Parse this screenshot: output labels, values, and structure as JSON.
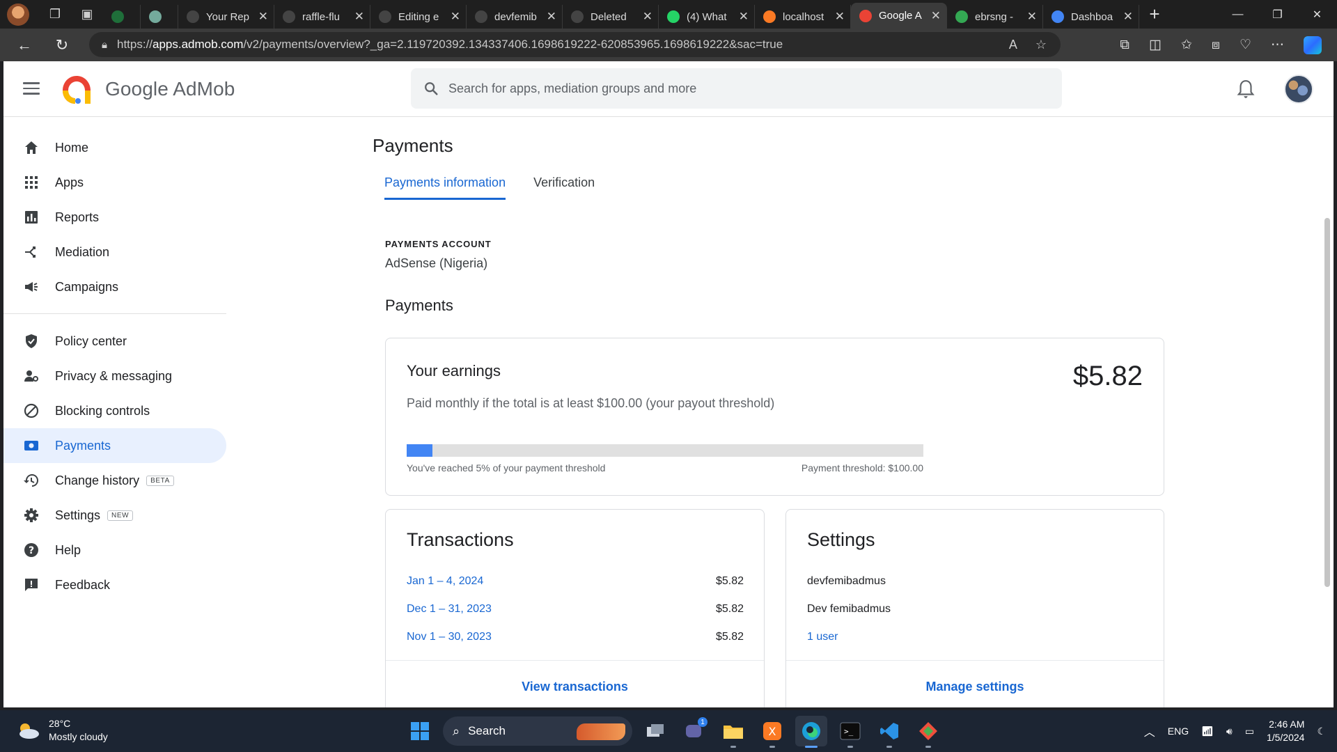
{
  "browser": {
    "tabs": [
      {
        "label": "",
        "favicon": "w-icon",
        "color": "#1f6f3a",
        "narrow": true
      },
      {
        "label": "",
        "favicon": "chatgpt-icon",
        "color": "#74aa9c",
        "narrow": true
      },
      {
        "label": "Your Rep",
        "favicon": "github-icon",
        "color": "#444"
      },
      {
        "label": "raffle-flu",
        "favicon": "github-icon",
        "color": "#444"
      },
      {
        "label": "Editing e",
        "favicon": "github-icon",
        "color": "#444"
      },
      {
        "label": "devfemib",
        "favicon": "github-icon",
        "color": "#444"
      },
      {
        "label": "Deleted",
        "favicon": "github-icon",
        "color": "#444"
      },
      {
        "label": "(4) What",
        "favicon": "whatsapp-icon",
        "color": "#25d366"
      },
      {
        "label": "localhost",
        "favicon": "xampp-icon",
        "color": "#fb7a24"
      },
      {
        "label": "Google A",
        "favicon": "admob-icon",
        "color": "#ea4335",
        "active": true
      },
      {
        "label": "ebrsng -",
        "favicon": "play-icon",
        "color": "#34a853"
      },
      {
        "label": "Dashboa",
        "favicon": "dashboard-icon",
        "color": "#4285f4"
      }
    ],
    "url_host": "apps.admob.com",
    "url_prefix": "https://",
    "url_path": "/v2/payments/overview?_ga=2.119720392.134337406.1698619222-620853965.1698619222&sac=true"
  },
  "app": {
    "brand": "Google AdMob",
    "search_placeholder": "Search for apps, mediation groups and more"
  },
  "sidebar": {
    "items_top": [
      {
        "label": "Home",
        "icon": "home-icon"
      },
      {
        "label": "Apps",
        "icon": "apps-grid-icon"
      },
      {
        "label": "Reports",
        "icon": "bar-chart-icon"
      },
      {
        "label": "Mediation",
        "icon": "mediation-icon"
      },
      {
        "label": "Campaigns",
        "icon": "megaphone-icon"
      }
    ],
    "items_bottom": [
      {
        "label": "Policy center",
        "icon": "shield-icon"
      },
      {
        "label": "Privacy & messaging",
        "icon": "person-settings-icon"
      },
      {
        "label": "Blocking controls",
        "icon": "block-icon"
      },
      {
        "label": "Payments",
        "icon": "payments-icon",
        "active": true
      },
      {
        "label": "Change history",
        "icon": "history-icon",
        "pill": "BETA"
      },
      {
        "label": "Settings",
        "icon": "gear-icon",
        "pill": "NEW"
      },
      {
        "label": "Help",
        "icon": "help-icon"
      },
      {
        "label": "Feedback",
        "icon": "feedback-icon"
      }
    ]
  },
  "main": {
    "title": "Payments",
    "tabs": [
      {
        "label": "Payments information",
        "active": true
      },
      {
        "label": "Verification"
      }
    ],
    "account_label": "PAYMENTS ACCOUNT",
    "account_value": "AdSense (Nigeria)",
    "section_title": "Payments",
    "earnings": {
      "title": "Your earnings",
      "amount": "$5.82",
      "subtitle": "Paid monthly if the total is at least $100.00 (your payout threshold)",
      "progress_percent": 5,
      "progress_left": "You've reached 5% of your payment threshold",
      "progress_right": "Payment threshold: $100.00"
    },
    "transactions": {
      "title": "Transactions",
      "rows": [
        {
          "date": "Jan 1 – 4, 2024",
          "amount": "$5.82"
        },
        {
          "date": "Dec 1 – 31, 2023",
          "amount": "$5.82"
        },
        {
          "date": "Nov 1 – 30, 2023",
          "amount": "$5.82"
        }
      ],
      "action": "View transactions"
    },
    "settings": {
      "title": "Settings",
      "line1": "devfemibadmus",
      "line2": "Dev femibadmus",
      "link": "1 user",
      "action": "Manage settings"
    }
  },
  "taskbar": {
    "temp": "28°C",
    "weather": "Mostly cloudy",
    "search": "Search",
    "lang": "ENG",
    "time": "2:46 AM",
    "date": "1/5/2024",
    "teams_badge": "1"
  },
  "colors": {
    "accent": "#1967d2",
    "progress": "#4285f4",
    "active_nav_bg": "#e8f0fe"
  }
}
